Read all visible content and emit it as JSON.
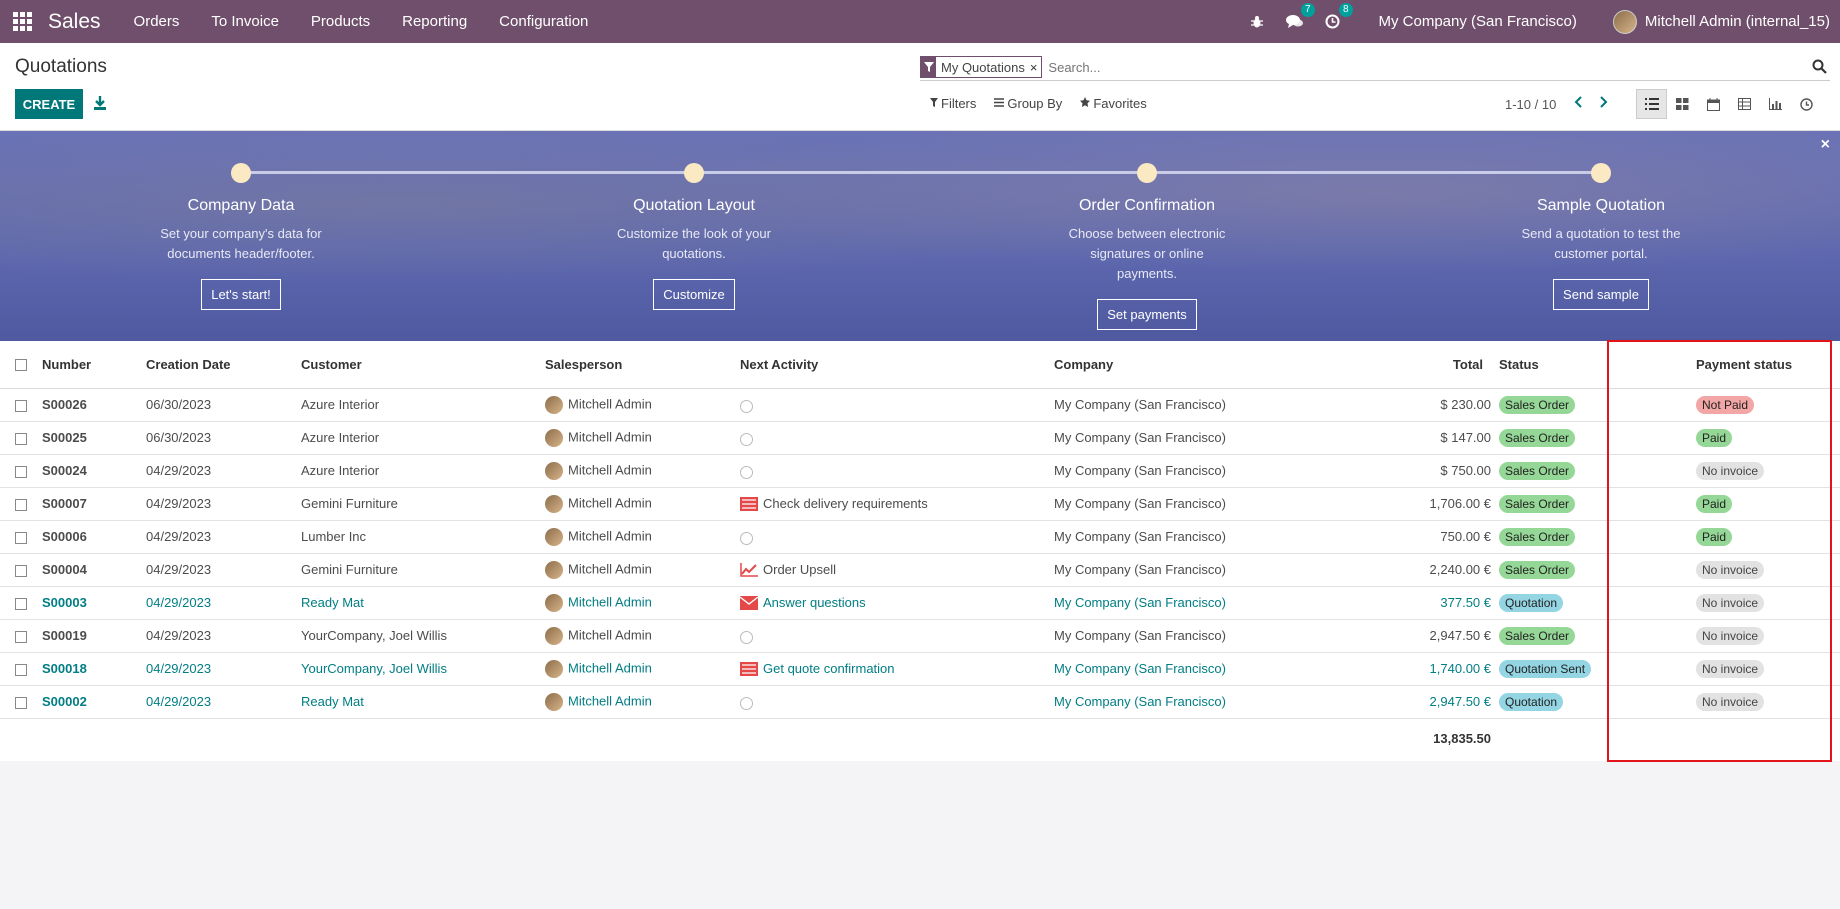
{
  "nav": {
    "brand": "Sales",
    "menu": [
      "Orders",
      "To Invoice",
      "Products",
      "Reporting",
      "Configuration"
    ],
    "messages_count": "7",
    "activities_count": "8",
    "company": "My Company (San Francisco)",
    "user": "Mitchell Admin (internal_15)"
  },
  "control": {
    "title": "Quotations",
    "create_label": "CREATE",
    "facet_label": "My Quotations",
    "facet_close": "×",
    "search_placeholder": "Search...",
    "filters_label": "Filters",
    "groupby_label": "Group By",
    "favorites_label": "Favorites",
    "pager": "1-10 / 10"
  },
  "banner": {
    "close": "×",
    "steps": [
      {
        "title": "Company Data",
        "desc": "Set your company's data for documents header/footer.",
        "button": "Let's start!"
      },
      {
        "title": "Quotation Layout",
        "desc": "Customize the look of your quotations.",
        "button": "Customize"
      },
      {
        "title": "Order Confirmation",
        "desc": "Choose between electronic signatures or online payments.",
        "button": "Set payments"
      },
      {
        "title": "Sample Quotation",
        "desc": "Send a quotation to test the customer portal.",
        "button": "Send sample"
      }
    ]
  },
  "table": {
    "headers": {
      "number": "Number",
      "date": "Creation Date",
      "customer": "Customer",
      "salesperson": "Salesperson",
      "activity": "Next Activity",
      "company": "Company",
      "total": "Total",
      "status": "Status",
      "payment": "Payment status"
    },
    "rows": [
      {
        "number": "S00026",
        "date": "06/30/2023",
        "customer": "Azure Interior",
        "salesperson": "Mitchell Admin",
        "activity": "",
        "activity_icon": "clock-icon",
        "company": "My Company (San Francisco)",
        "total": "$ 230.00",
        "status": "Sales Order",
        "status_color": "green",
        "payment": "Not Paid",
        "payment_color": "red",
        "blue": false
      },
      {
        "number": "S00025",
        "date": "06/30/2023",
        "customer": "Azure Interior",
        "salesperson": "Mitchell Admin",
        "activity": "",
        "activity_icon": "clock-icon",
        "company": "My Company (San Francisco)",
        "total": "$ 147.00",
        "status": "Sales Order",
        "status_color": "green",
        "payment": "Paid",
        "payment_color": "green",
        "blue": false
      },
      {
        "number": "S00024",
        "date": "04/29/2023",
        "customer": "Azure Interior",
        "salesperson": "Mitchell Admin",
        "activity": "",
        "activity_icon": "clock-icon",
        "company": "My Company (San Francisco)",
        "total": "$ 750.00",
        "status": "Sales Order",
        "status_color": "green",
        "payment": "No invoice",
        "payment_color": "grey",
        "blue": false
      },
      {
        "number": "S00007",
        "date": "04/29/2023",
        "customer": "Gemini Furniture",
        "salesperson": "Mitchell Admin",
        "activity": "Check delivery requirements",
        "activity_icon": "tasks-icon",
        "company": "My Company (San Francisco)",
        "total": "1,706.00 €",
        "status": "Sales Order",
        "status_color": "green",
        "payment": "Paid",
        "payment_color": "green",
        "blue": false
      },
      {
        "number": "S00006",
        "date": "04/29/2023",
        "customer": "Lumber Inc",
        "salesperson": "Mitchell Admin",
        "activity": "",
        "activity_icon": "clock-icon",
        "company": "My Company (San Francisco)",
        "total": "750.00 €",
        "status": "Sales Order",
        "status_color": "green",
        "payment": "Paid",
        "payment_color": "green",
        "blue": false
      },
      {
        "number": "S00004",
        "date": "04/29/2023",
        "customer": "Gemini Furniture",
        "salesperson": "Mitchell Admin",
        "activity": "Order Upsell",
        "activity_icon": "line-chart-icon",
        "company": "My Company (San Francisco)",
        "total": "2,240.00 €",
        "status": "Sales Order",
        "status_color": "green",
        "payment": "No invoice",
        "payment_color": "grey",
        "blue": false
      },
      {
        "number": "S00003",
        "date": "04/29/2023",
        "customer": "Ready Mat",
        "salesperson": "Mitchell Admin",
        "activity": "Answer questions",
        "activity_icon": "envelope-icon",
        "company": "My Company (San Francisco)",
        "total": "377.50 €",
        "status": "Quotation",
        "status_color": "cyan",
        "payment": "No invoice",
        "payment_color": "grey",
        "blue": true
      },
      {
        "number": "S00019",
        "date": "04/29/2023",
        "customer": "YourCompany, Joel Willis",
        "salesperson": "Mitchell Admin",
        "activity": "",
        "activity_icon": "clock-icon",
        "company": "My Company (San Francisco)",
        "total": "2,947.50 €",
        "status": "Sales Order",
        "status_color": "green",
        "payment": "No invoice",
        "payment_color": "grey",
        "blue": false
      },
      {
        "number": "S00018",
        "date": "04/29/2023",
        "customer": "YourCompany, Joel Willis",
        "salesperson": "Mitchell Admin",
        "activity": "Get quote confirmation",
        "activity_icon": "tasks-icon",
        "company": "My Company (San Francisco)",
        "total": "1,740.00 €",
        "status": "Quotation Sent",
        "status_color": "cyan",
        "payment": "No invoice",
        "payment_color": "grey",
        "blue": true
      },
      {
        "number": "S00002",
        "date": "04/29/2023",
        "customer": "Ready Mat",
        "salesperson": "Mitchell Admin",
        "activity": "",
        "activity_icon": "clock-icon",
        "company": "My Company (San Francisco)",
        "total": "2,947.50 €",
        "status": "Quotation",
        "status_color": "cyan",
        "payment": "No invoice",
        "payment_color": "grey",
        "blue": true
      }
    ],
    "grand_total": "13,835.50"
  },
  "colors": {
    "nav_bg": "#6f4f6b",
    "primary": "#00787a",
    "link": "#017e84",
    "highlight": "#e0141a"
  }
}
